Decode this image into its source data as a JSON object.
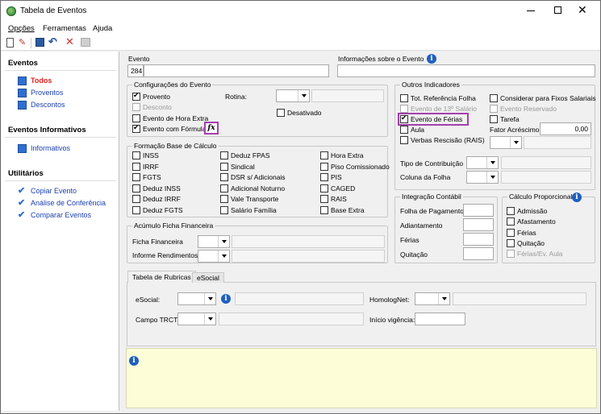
{
  "window": {
    "title": "Tabela de Eventos"
  },
  "menu": [
    "Opções",
    "Ferramentas",
    "Ajuda"
  ],
  "sidebar": {
    "sections": [
      {
        "title": "Eventos",
        "items": [
          "Todos",
          "Proventos",
          "Descontos"
        ]
      },
      {
        "title": "Eventos Informativos",
        "items": [
          "Informativos"
        ]
      },
      {
        "title": "Utilitários",
        "items": [
          "Copiar Evento",
          "Análise de Conferência",
          "Comparar Eventos"
        ]
      }
    ],
    "active_item": "Todos"
  },
  "evento": {
    "label": "Evento",
    "value": "284"
  },
  "info_evento": {
    "label": "Informações sobre o Evento"
  },
  "config": {
    "title": "Configurações do Evento",
    "provento": "Provento",
    "desconto": "Desconto",
    "hora_extra": "Evento de Hora Extra",
    "formula": "Evento com Fórmula",
    "rotina": "Rotina:",
    "desativado": "Desativado"
  },
  "formacao": {
    "title": "Formação Base de Cálculo",
    "col1": [
      "INSS",
      "IRRF",
      "FGTS",
      "Deduz INSS",
      "Deduz IRRF",
      "Deduz FGTS"
    ],
    "col2": [
      "Deduz FPAS",
      "Sindical",
      "DSR s/ Adicionais",
      "Adicional Noturno",
      "Vale Transporte",
      "Salário Família"
    ],
    "col3": [
      "Hora Extra",
      "Piso Comissionado",
      "PIS",
      "CAGED",
      "RAIS",
      "Base Extra"
    ]
  },
  "acumulo": {
    "title": "Acúmulo Ficha Financeira",
    "ficha": "Ficha Financeira",
    "informe": "Informe Rendimentos"
  },
  "outros": {
    "title": "Outros Indicadores",
    "tot_ref": "Tot. Referência Folha",
    "decimo": "Evento de 13º Salário",
    "ferias": "Evento de Férias",
    "aula": "Aula",
    "verbas": "Verbas Rescisão (RAIS)",
    "fixos": "Considerar para Fixos Salariais",
    "reservado": "Evento Reservado",
    "tarefa": "Tarefa",
    "fator": "Fator Acréscimo",
    "fator_value": "0,00",
    "tipo": "Tipo de Contribuição",
    "coluna": "Coluna da Folha"
  },
  "integracao": {
    "title": "Integração Contábil",
    "items": [
      "Folha de Pagamento",
      "Adiantamento",
      "Férias",
      "Quitação"
    ]
  },
  "proporcional": {
    "title": "Cálculo Proporcional",
    "items": [
      "Admissão",
      "Afastamento",
      "Férias",
      "Quitação",
      "Férias/Ev. Aula"
    ]
  },
  "tabs": [
    "Tabela de Rubricas",
    "eSocial"
  ],
  "esocial": {
    "esocial": "eSocial:",
    "homolognet": "HomologNet:",
    "trct": "Campo TRCT:",
    "vigencia": "Início vigência:"
  }
}
